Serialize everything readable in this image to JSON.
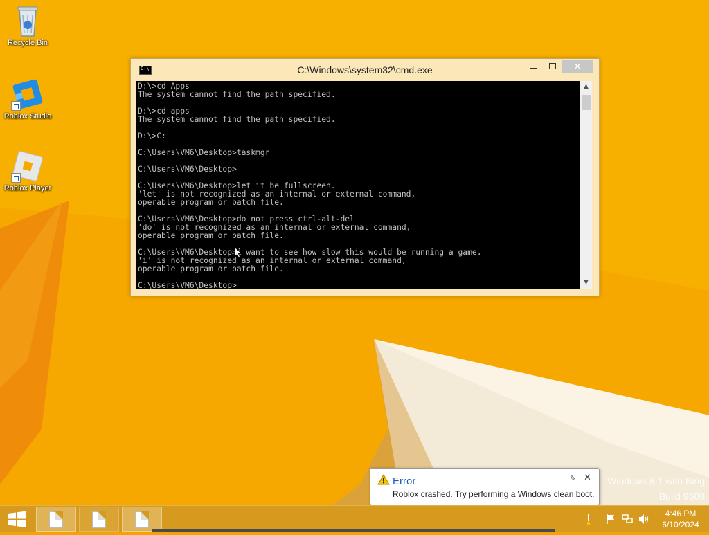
{
  "desktop": {
    "icons": [
      {
        "label": "Recycle Bin"
      },
      {
        "label": "Roblox Studio"
      },
      {
        "label": "Roblox Player"
      }
    ],
    "watermark": {
      "line1": "Windows 8.1 with Bing",
      "line2": "Build 9600"
    }
  },
  "cmd": {
    "title": "C:\\Windows\\system32\\cmd.exe",
    "output": "D:\\>cd Apps\nThe system cannot find the path specified.\n\nD:\\>cd apps\nThe system cannot find the path specified.\n\nD:\\>C:\n\nC:\\Users\\VM6\\Desktop>taskmgr\n\nC:\\Users\\VM6\\Desktop>\n\nC:\\Users\\VM6\\Desktop>let it be fullscreen.\n'let' is not recognized as an internal or external command,\noperable program or batch file.\n\nC:\\Users\\VM6\\Desktop>do not press ctrl-alt-del\n'do' is not recognized as an internal or external command,\noperable program or batch file.\n\nC:\\Users\\VM6\\Desktop>i want to see how slow this would be running a game.\n'i' is not recognized as an internal or external command,\noperable program or batch file.\n\nC:\\Users\\VM6\\Desktop>"
  },
  "notification": {
    "title": "Error",
    "message": "Roblox crashed. Try performing a Windows clean boot."
  },
  "taskbar": {
    "clock_time": "4:46 PM",
    "clock_date": "6/10/2024"
  },
  "colors": {
    "desktop_bg": "#f5a300",
    "taskbar": "#d69a1f",
    "error_title": "#1e5db5"
  }
}
